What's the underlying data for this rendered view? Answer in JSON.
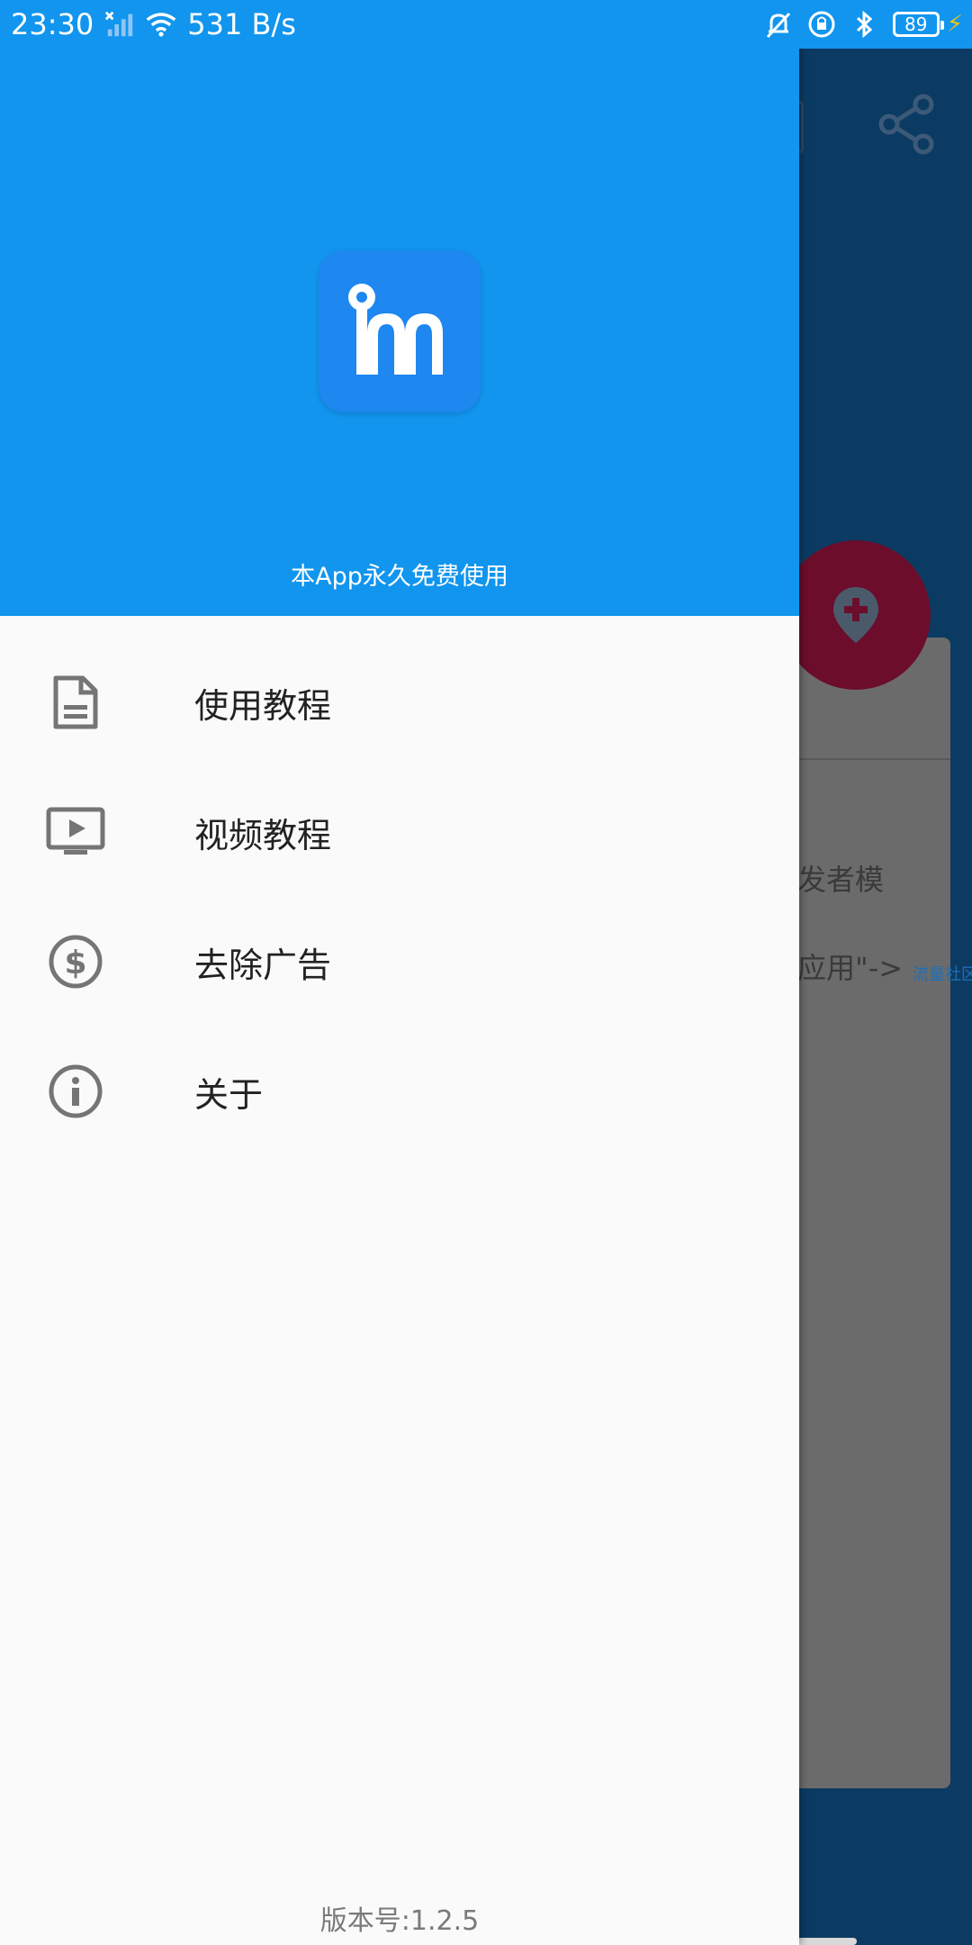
{
  "status_bar": {
    "time": "23:30",
    "network_speed": "531 B/s",
    "battery_level": "89",
    "icons": [
      "signal-off-icon",
      "wifi-icon",
      "alarm-off-icon",
      "screen-lock-icon",
      "bluetooth-icon",
      "battery-icon",
      "charging-icon"
    ]
  },
  "background_app": {
    "text_line1": "发者模",
    "text_line2": "应用\"->",
    "link_text": "流量社区",
    "icons": [
      "share-icon",
      "add-location-icon"
    ],
    "fab_color": "#6b0d2b"
  },
  "drawer": {
    "header_color": "#1195ee",
    "caption": "本App永久免费使用",
    "menu": [
      {
        "label": "使用教程",
        "icon": "document-icon"
      },
      {
        "label": "视频教程",
        "icon": "video-play-icon"
      },
      {
        "label": "去除广告",
        "icon": "dollar-icon"
      },
      {
        "label": "关于",
        "icon": "info-icon"
      }
    ],
    "version": "版本号:1.2.5"
  }
}
